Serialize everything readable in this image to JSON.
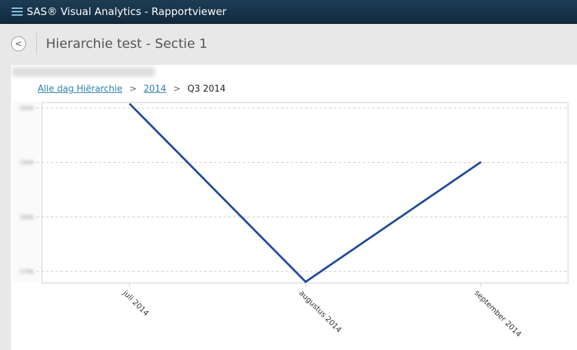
{
  "app": {
    "title": "SAS® Visual Analytics - Rapportviewer",
    "menu_icon": "hamburger-icon"
  },
  "page": {
    "title": "Hierarchie test - Sectie 1",
    "back_icon": "chevron-left-icon"
  },
  "breadcrumb": {
    "items": [
      "Alle dag Hiërarchie",
      "2014"
    ],
    "current": "Q3 2014",
    "separator": ">"
  },
  "colors": {
    "line": "#1f4a9a",
    "header": "#14304a",
    "link": "#2a7fb0"
  },
  "chart_data": {
    "type": "line",
    "title": "",
    "categories": [
      "juli 2014",
      "augustus 2014",
      "september 2014"
    ],
    "series": [
      {
        "values": [
          2008,
          1681,
          1901
        ]
      }
    ],
    "yticks": [
      2000,
      1900,
      1800,
      1700
    ],
    "ylim": [
      1670,
      2010
    ],
    "grid": "horizontal dashed",
    "xlabel_rotation": "45deg",
    "note_title_and_ticks": "blurred"
  }
}
